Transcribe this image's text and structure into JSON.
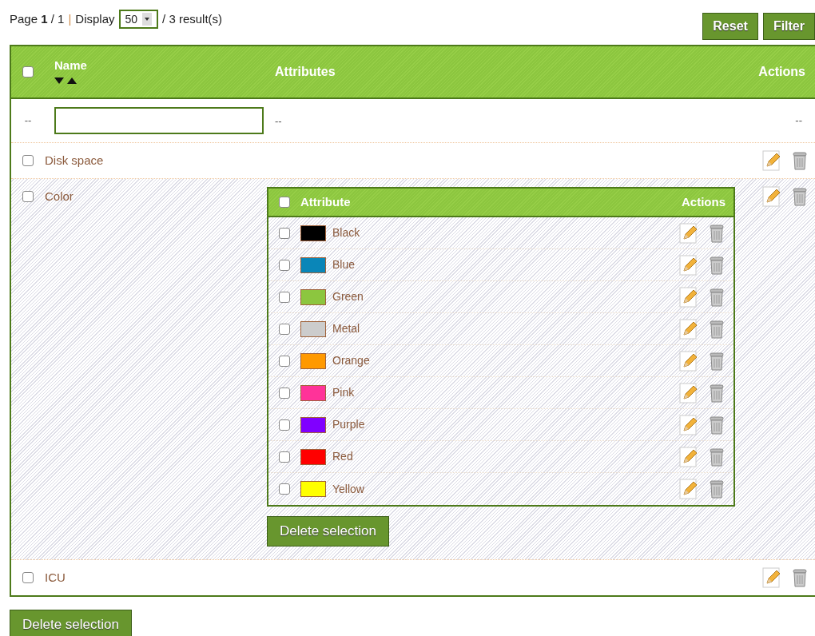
{
  "pagination": {
    "page": "Page **1** / 1",
    "separator": "|",
    "display_label": "Display",
    "per_page": "50",
    "results": "/ 3 result(s)"
  },
  "buttons": [
    "Reset",
    "Filter"
  ],
  "table": {
    "columns": [
      "Name",
      "Attributes",
      "Actions"
    ],
    "header_checked": false,
    "filter_row": [
      "--",
      "--",
      "--"
    ],
    "rows": [
      {
        "name": "Disk space",
        "checked": false,
        "expanded": false
      },
      {
        "name": "Color",
        "checked": false,
        "expanded": true,
        "attributes": {
          "columns": [
            "Attribute",
            "Actions"
          ],
          "header_checked": false,
          "items": [
            {
              "name": "Black",
              "color": "#000000",
              "checked": false
            },
            {
              "name": "Blue",
              "color": "#0a86b8",
              "checked": false
            },
            {
              "name": "Green",
              "color": "#8cc63f",
              "checked": false
            },
            {
              "name": "Metal",
              "color": "#cccccc",
              "checked": false
            },
            {
              "name": "Orange",
              "color": "#ff9900",
              "checked": false
            },
            {
              "name": "Pink",
              "color": "#ff3399",
              "checked": false
            },
            {
              "name": "Purple",
              "color": "#8000ff",
              "checked": false
            },
            {
              "name": "Red",
              "color": "#ff0000",
              "checked": false
            },
            {
              "name": "Yellow",
              "color": "#ffff00",
              "checked": false
            }
          ],
          "delete_button": "Delete selection"
        }
      },
      {
        "name": "ICU",
        "checked": false,
        "expanded": false
      }
    ]
  },
  "delete_button": "Delete selection"
}
